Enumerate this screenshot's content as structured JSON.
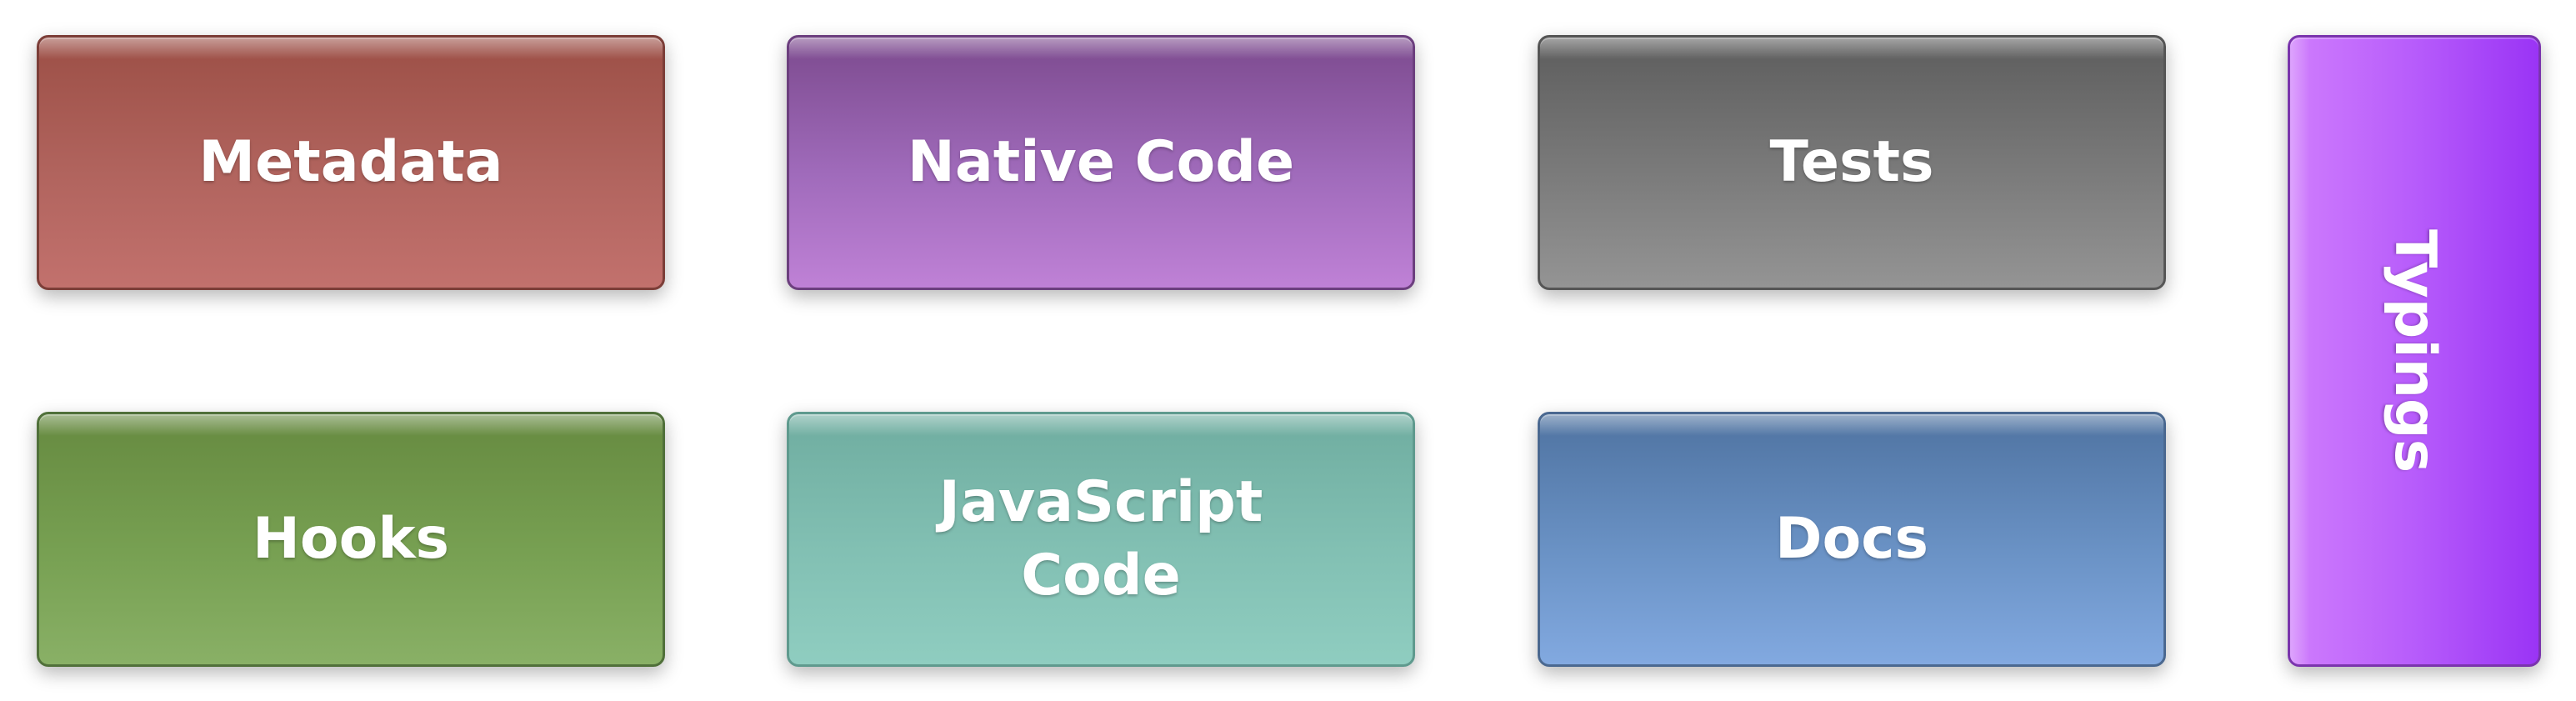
{
  "boxes": {
    "metadata": {
      "label": "Metadata",
      "color": "#b1645e"
    },
    "native_code": {
      "label": "Native Code",
      "color": "#a06bbb"
    },
    "tests": {
      "label": "Tests",
      "color": "#7b7b7b"
    },
    "hooks": {
      "label": "Hooks",
      "color": "#77a052"
    },
    "javascript_code": {
      "label_line1": "JavaScript",
      "label_line2": "Code",
      "color": "#82c0b3"
    },
    "docs": {
      "label": "Docs",
      "color": "#6a92c5"
    },
    "typings": {
      "label": "Typings",
      "color": "#b75cfb"
    }
  }
}
